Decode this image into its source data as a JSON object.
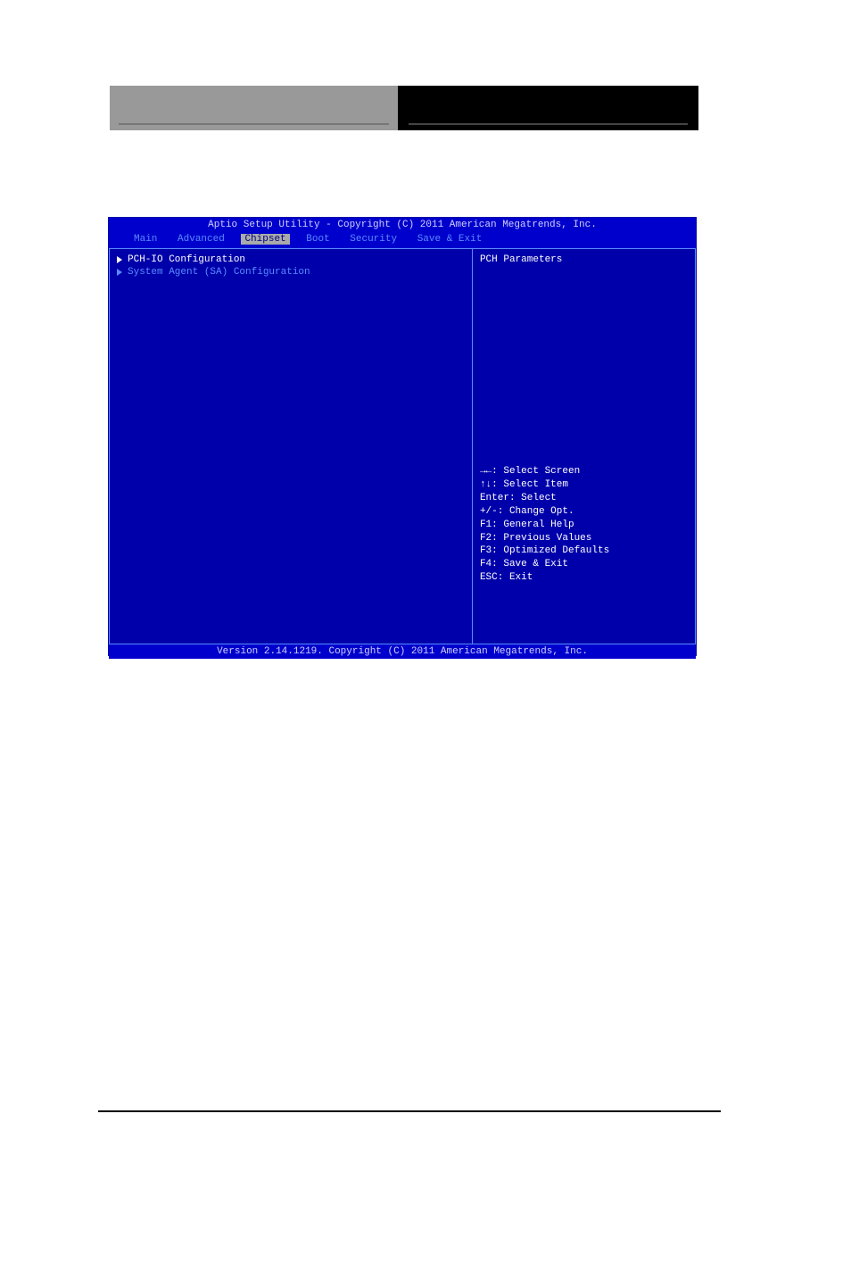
{
  "bios": {
    "title": "Aptio Setup Utility - Copyright (C) 2011 American Megatrends, Inc.",
    "menu": {
      "items": [
        "Main",
        "Advanced",
        "Chipset",
        "Boot",
        "Security",
        "Save & Exit"
      ],
      "active_index": 2
    },
    "left_panel": {
      "items": [
        {
          "label": "PCH-IO Configuration",
          "selected": true
        },
        {
          "label": "System Agent (SA) Configuration",
          "selected": false
        }
      ]
    },
    "right_panel": {
      "help": "PCH Parameters",
      "keys": [
        "→←: Select Screen",
        "↑↓: Select Item",
        "Enter: Select",
        "+/-: Change Opt.",
        "F1: General Help",
        "F2: Previous Values",
        "F3: Optimized Defaults",
        "F4: Save & Exit",
        "ESC: Exit"
      ]
    },
    "footer": "Version 2.14.1219. Copyright (C) 2011 American Megatrends, Inc."
  }
}
